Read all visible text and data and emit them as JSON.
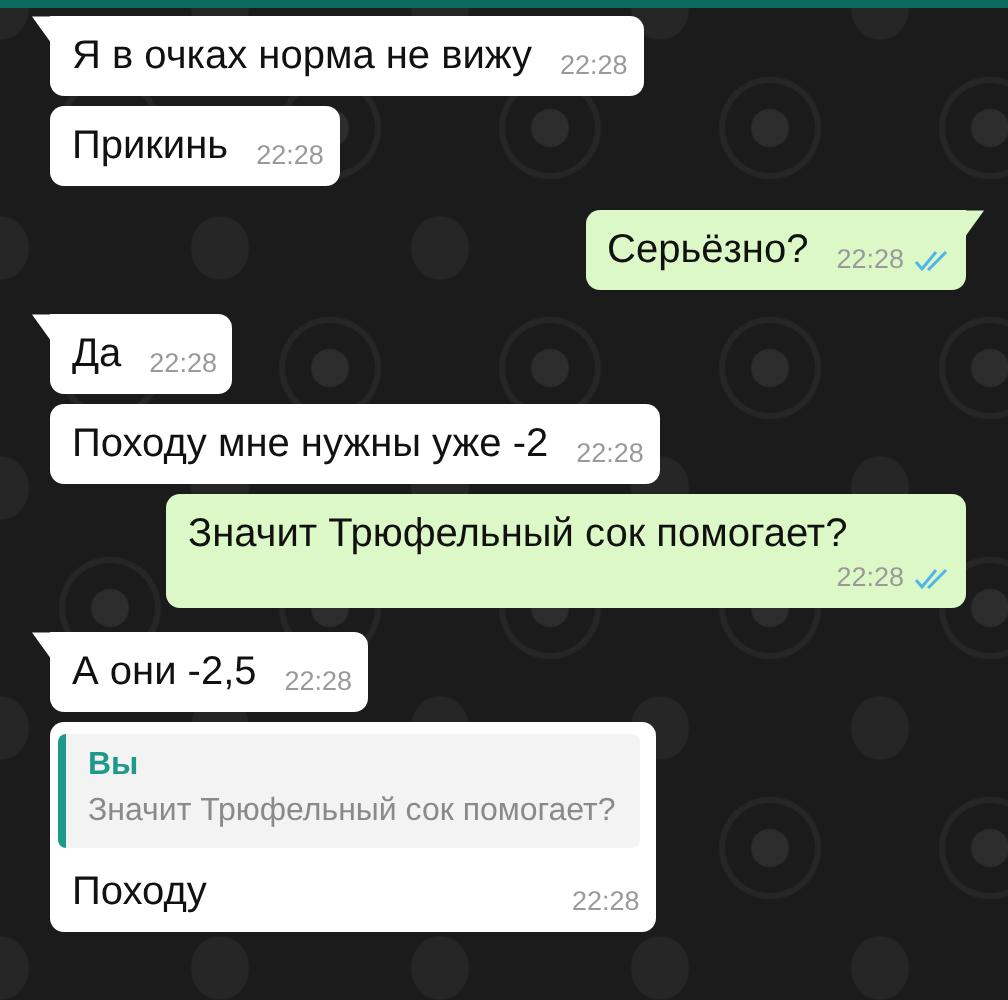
{
  "messages": [
    {
      "kind": "incoming",
      "tail": true,
      "text": "Я в очках норма не вижу",
      "time": "22:28"
    },
    {
      "kind": "incoming",
      "tail": false,
      "text": "Прикинь",
      "time": "22:28"
    },
    {
      "kind": "outgoing",
      "tail": true,
      "text": "Серьёзно?",
      "time": "22:28",
      "read": true
    },
    {
      "kind": "incoming",
      "tail": true,
      "text": "Да",
      "time": "22:28"
    },
    {
      "kind": "incoming",
      "tail": false,
      "text": "Походу мне нужны уже -2",
      "time": "22:28"
    },
    {
      "kind": "outgoing",
      "tail": false,
      "text": "Значит Трюфельный сок помогает?",
      "time": "22:28",
      "read": true
    },
    {
      "kind": "incoming",
      "tail": true,
      "text": "А они -2,5",
      "time": "22:28"
    },
    {
      "kind": "incoming",
      "tail": false,
      "quote": {
        "author": "Вы",
        "text": "Значит Трюфельный сок помогает?"
      },
      "text": "Походу",
      "time": "22:28"
    }
  ]
}
